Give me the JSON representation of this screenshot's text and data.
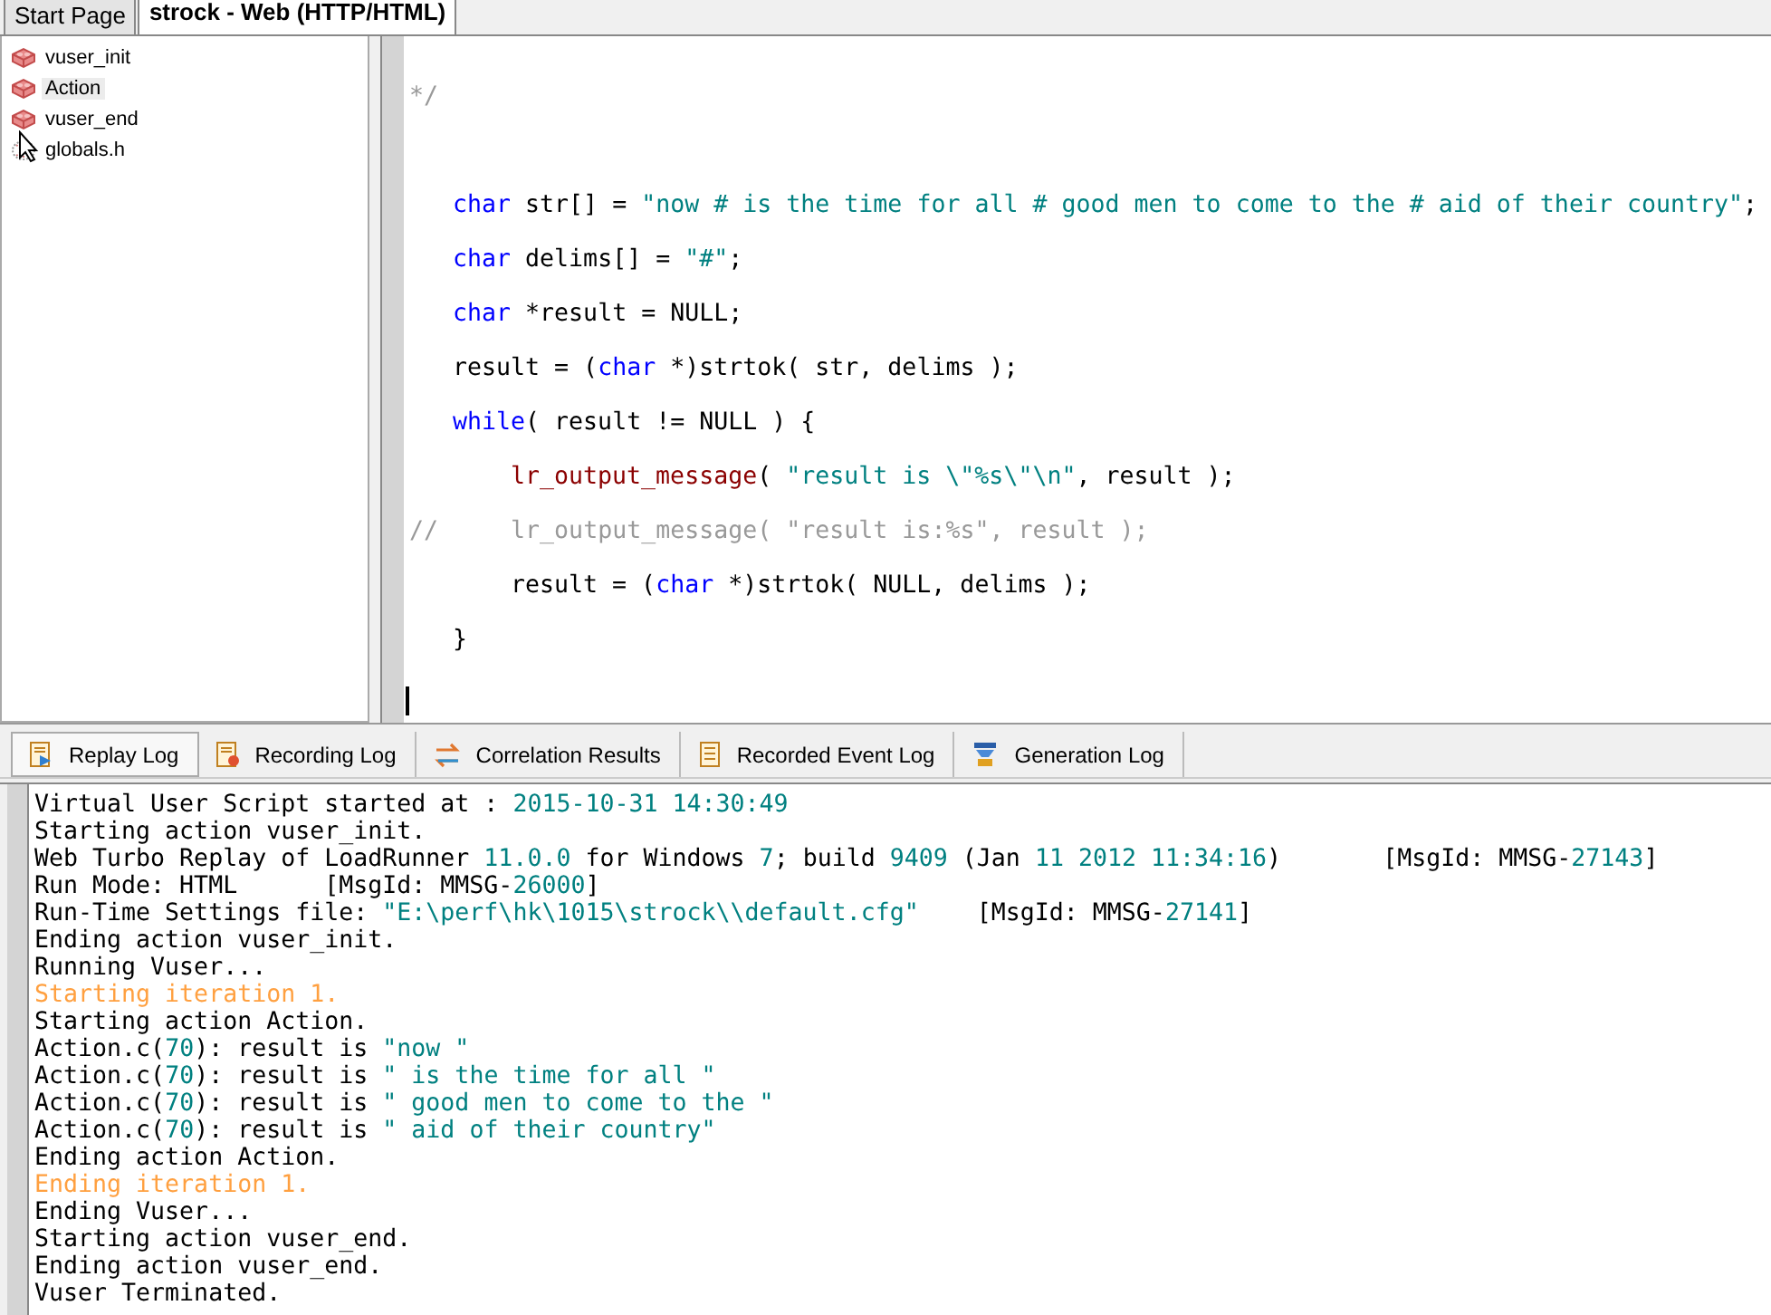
{
  "document_tabs": [
    {
      "label": "Start Page",
      "selected": false
    },
    {
      "label": "strock - Web (HTTP/HTML)",
      "selected": true
    }
  ],
  "script_tree": [
    {
      "label": "vuser_init",
      "kind": "action",
      "selected": false
    },
    {
      "label": "Action",
      "kind": "action",
      "selected": true
    },
    {
      "label": "vuser_end",
      "kind": "action",
      "selected": false
    },
    {
      "label": "globals.h",
      "kind": "header",
      "selected": false
    }
  ],
  "code_lines": [
    {
      "kind": "top",
      "segments": [
        {
          "kind": "comment",
          "text": "*/"
        }
      ]
    },
    {
      "kind": "blank"
    },
    {
      "kind": "block",
      "segments": [
        {
          "kind": "keyword",
          "text": "char"
        },
        {
          "kind": "plain",
          "text": " str[] = "
        },
        {
          "kind": "string",
          "text": "\"now # is the time for all # good men to come to the # aid of their country\""
        },
        {
          "kind": "plain",
          "text": ";"
        }
      ]
    },
    {
      "kind": "block",
      "segments": [
        {
          "kind": "keyword",
          "text": "char"
        },
        {
          "kind": "plain",
          "text": " delims[] = "
        },
        {
          "kind": "string",
          "text": "\"#\""
        },
        {
          "kind": "plain",
          "text": ";"
        }
      ]
    },
    {
      "kind": "block",
      "segments": [
        {
          "kind": "keyword",
          "text": "char"
        },
        {
          "kind": "plain",
          "text": " *result = NULL;"
        }
      ]
    },
    {
      "kind": "block",
      "segments": [
        {
          "kind": "plain",
          "text": "result = ("
        },
        {
          "kind": "keyword",
          "text": "char"
        },
        {
          "kind": "plain",
          "text": " *)strtok( str, delims );"
        }
      ]
    },
    {
      "kind": "block",
      "segments": [
        {
          "kind": "keyword",
          "text": "while"
        },
        {
          "kind": "plain",
          "text": "( result != NULL ) {"
        }
      ]
    },
    {
      "kind": "nested",
      "segments": [
        {
          "kind": "function",
          "text": "lr_output_message"
        },
        {
          "kind": "plain",
          "text": "( "
        },
        {
          "kind": "string",
          "text": "\"result is \\\"%s\\\"\\n\""
        },
        {
          "kind": "plain",
          "text": ", result );"
        }
      ]
    },
    {
      "kind": "top",
      "segments": [
        {
          "kind": "comment",
          "text": "//     lr_output_message( \"result is:%s\", result );"
        }
      ]
    },
    {
      "kind": "nested",
      "segments": [
        {
          "kind": "plain",
          "text": "result = ("
        },
        {
          "kind": "keyword",
          "text": "char"
        },
        {
          "kind": "plain",
          "text": " *)strtok( NULL, delims );"
        }
      ]
    },
    {
      "kind": "block",
      "segments": [
        {
          "kind": "plain",
          "text": "}"
        }
      ]
    },
    {
      "kind": "blank"
    }
  ],
  "log_tabs": [
    {
      "label": "Replay Log",
      "selected": true
    },
    {
      "label": "Recording Log",
      "selected": false
    },
    {
      "label": "Correlation Results",
      "selected": false
    },
    {
      "label": "Recorded Event Log",
      "selected": false
    },
    {
      "label": "Generation Log",
      "selected": false
    }
  ],
  "log_lines": [
    {
      "kind": "normal",
      "segments": [
        {
          "kind": "plain",
          "text": "Virtual User Script started at : "
        },
        {
          "kind": "value",
          "text": "2015-10-31 14:30:49"
        }
      ]
    },
    {
      "kind": "normal",
      "segments": [
        {
          "kind": "plain",
          "text": "Starting action vuser_init."
        }
      ]
    },
    {
      "kind": "normal",
      "segments": [
        {
          "kind": "plain",
          "text": "Web Turbo Replay of LoadRunner "
        },
        {
          "kind": "value",
          "text": "11.0.0"
        },
        {
          "kind": "plain",
          "text": " for Windows "
        },
        {
          "kind": "value",
          "text": "7"
        },
        {
          "kind": "plain",
          "text": "; build "
        },
        {
          "kind": "value",
          "text": "9409"
        },
        {
          "kind": "plain",
          "text": " (Jan "
        },
        {
          "kind": "value",
          "text": "11 2012 11:34:16"
        },
        {
          "kind": "plain",
          "text": ")       [MsgId: MMSG-"
        },
        {
          "kind": "value",
          "text": "27143"
        },
        {
          "kind": "plain",
          "text": "]"
        }
      ]
    },
    {
      "kind": "normal",
      "segments": [
        {
          "kind": "plain",
          "text": "Run Mode: HTML      [MsgId: MMSG-"
        },
        {
          "kind": "value",
          "text": "26000"
        },
        {
          "kind": "plain",
          "text": "]"
        }
      ]
    },
    {
      "kind": "normal",
      "segments": [
        {
          "kind": "plain",
          "text": "Run-Time Settings file: "
        },
        {
          "kind": "value",
          "text": "\"E:\\perf\\hk\\1015\\strock\\\\default.cfg\""
        },
        {
          "kind": "plain",
          "text": "    [MsgId: MMSG-"
        },
        {
          "kind": "value",
          "text": "27141"
        },
        {
          "kind": "plain",
          "text": "]"
        }
      ]
    },
    {
      "kind": "normal",
      "segments": [
        {
          "kind": "plain",
          "text": "Ending action vuser_init."
        }
      ]
    },
    {
      "kind": "normal",
      "segments": [
        {
          "kind": "plain",
          "text": "Running Vuser..."
        }
      ]
    },
    {
      "kind": "iteration",
      "segments": [
        {
          "kind": "plain",
          "text": "Starting iteration 1."
        }
      ]
    },
    {
      "kind": "normal",
      "segments": [
        {
          "kind": "plain",
          "text": "Starting action Action."
        }
      ]
    },
    {
      "kind": "normal",
      "segments": [
        {
          "kind": "plain",
          "text": "Action.c("
        },
        {
          "kind": "value",
          "text": "70"
        },
        {
          "kind": "plain",
          "text": "): result is "
        },
        {
          "kind": "value",
          "text": "\"now \""
        }
      ]
    },
    {
      "kind": "normal",
      "segments": [
        {
          "kind": "plain",
          "text": "Action.c("
        },
        {
          "kind": "value",
          "text": "70"
        },
        {
          "kind": "plain",
          "text": "): result is "
        },
        {
          "kind": "value",
          "text": "\" is the time for all \""
        }
      ]
    },
    {
      "kind": "normal",
      "segments": [
        {
          "kind": "plain",
          "text": "Action.c("
        },
        {
          "kind": "value",
          "text": "70"
        },
        {
          "kind": "plain",
          "text": "): result is "
        },
        {
          "kind": "value",
          "text": "\" good men to come to the \""
        }
      ]
    },
    {
      "kind": "normal",
      "segments": [
        {
          "kind": "plain",
          "text": "Action.c("
        },
        {
          "kind": "value",
          "text": "70"
        },
        {
          "kind": "plain",
          "text": "): result is "
        },
        {
          "kind": "value",
          "text": "\" aid of their country\""
        }
      ]
    },
    {
      "kind": "normal",
      "segments": [
        {
          "kind": "plain",
          "text": "Ending action Action."
        }
      ]
    },
    {
      "kind": "iteration",
      "segments": [
        {
          "kind": "plain",
          "text": "Ending iteration 1."
        }
      ]
    },
    {
      "kind": "normal",
      "segments": [
        {
          "kind": "plain",
          "text": "Ending Vuser..."
        }
      ]
    },
    {
      "kind": "normal",
      "segments": [
        {
          "kind": "plain",
          "text": "Starting action vuser_end."
        }
      ]
    },
    {
      "kind": "normal",
      "segments": [
        {
          "kind": "plain",
          "text": "Ending action vuser_end."
        }
      ]
    },
    {
      "kind": "normal",
      "segments": [
        {
          "kind": "plain",
          "text": "Vuser Terminated."
        }
      ]
    }
  ]
}
